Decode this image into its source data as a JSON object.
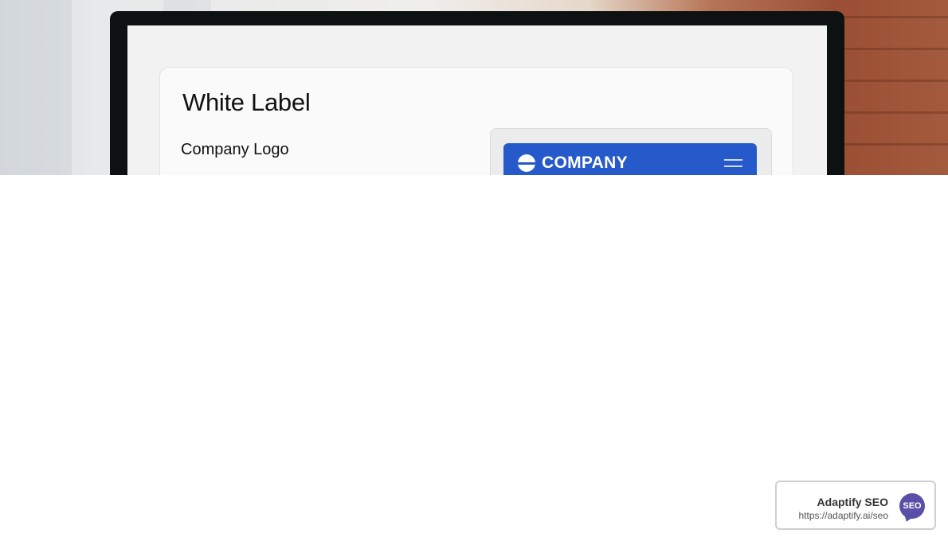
{
  "card": {
    "title": "White Label",
    "field_label": "Company Logo"
  },
  "preview": {
    "brand_name": "COMPANY",
    "bar_color": "#2659c9"
  },
  "badge": {
    "name": "Adaptify SEO",
    "url": "https://adaptify.ai/seo",
    "icon_text": "SEO",
    "icon_color": "#5a4fa8"
  },
  "icons": {
    "logo": "company-logo-icon",
    "menu": "hamburger-menu-icon"
  }
}
